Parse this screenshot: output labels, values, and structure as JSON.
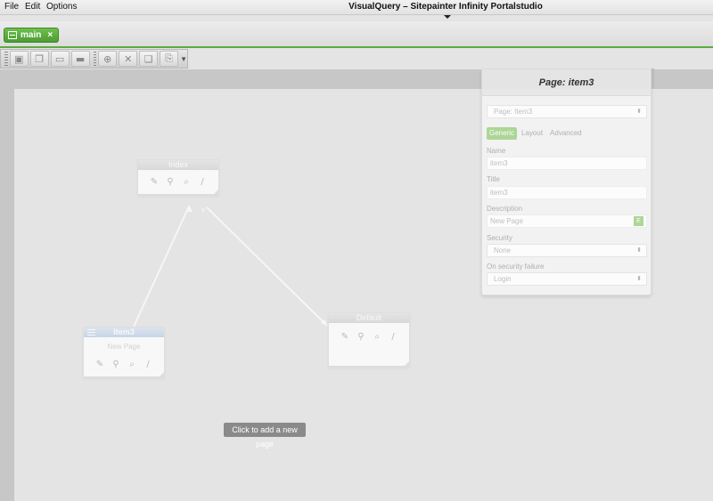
{
  "menu": {
    "file": "File",
    "edit": "Edit",
    "options": "Options"
  },
  "window": {
    "title": "VisualQuery – Sitepainter Infinity Portalstudio"
  },
  "tabs": [
    {
      "label": "main",
      "close": "×"
    }
  ],
  "toolbar": {
    "buttons": [
      {
        "icon": "page-add-icon",
        "glyph": "▣"
      },
      {
        "icon": "page-copy-icon",
        "glyph": "❐"
      },
      {
        "icon": "align-icon",
        "glyph": "▭"
      },
      {
        "icon": "layout-icon",
        "glyph": "▬"
      },
      {
        "icon": "zoom-in-icon",
        "glyph": "⊕"
      },
      {
        "icon": "delete-icon",
        "glyph": "✕"
      },
      {
        "icon": "copy-icon",
        "glyph": "❏"
      },
      {
        "icon": "paste-icon",
        "glyph": "⎘"
      }
    ]
  },
  "nodes": {
    "index": {
      "title": "Index"
    },
    "item3": {
      "title": "Item3",
      "subtitle": "New Page"
    },
    "default": {
      "title": "Default"
    },
    "icons": {
      "edit": "✎",
      "link": "⚲",
      "search": "⌕",
      "pen": "/"
    }
  },
  "tooltip": "Click to add a new page",
  "panel": {
    "title": "Page: item3",
    "page_select": "Page: Item3",
    "tabs": {
      "generic": "Generic",
      "layout": "Layout",
      "advanced": "Advanced"
    },
    "fields": {
      "name_label": "Name",
      "name_value": "item3",
      "title_label": "Title",
      "title_value": "item3",
      "description_label": "Description",
      "description_value": "New Page",
      "description_btn": "E",
      "security_label": "Security",
      "security_value": "None",
      "failure_label": "On security failure",
      "failure_value": "Login"
    }
  },
  "colors": {
    "accent": "#5cab3e",
    "tab_green": "#6ec04d",
    "node_head": "#d5d5d5",
    "selected_node_head": "#bfd0e6",
    "tooltip_bg": "#8a8a8a"
  }
}
